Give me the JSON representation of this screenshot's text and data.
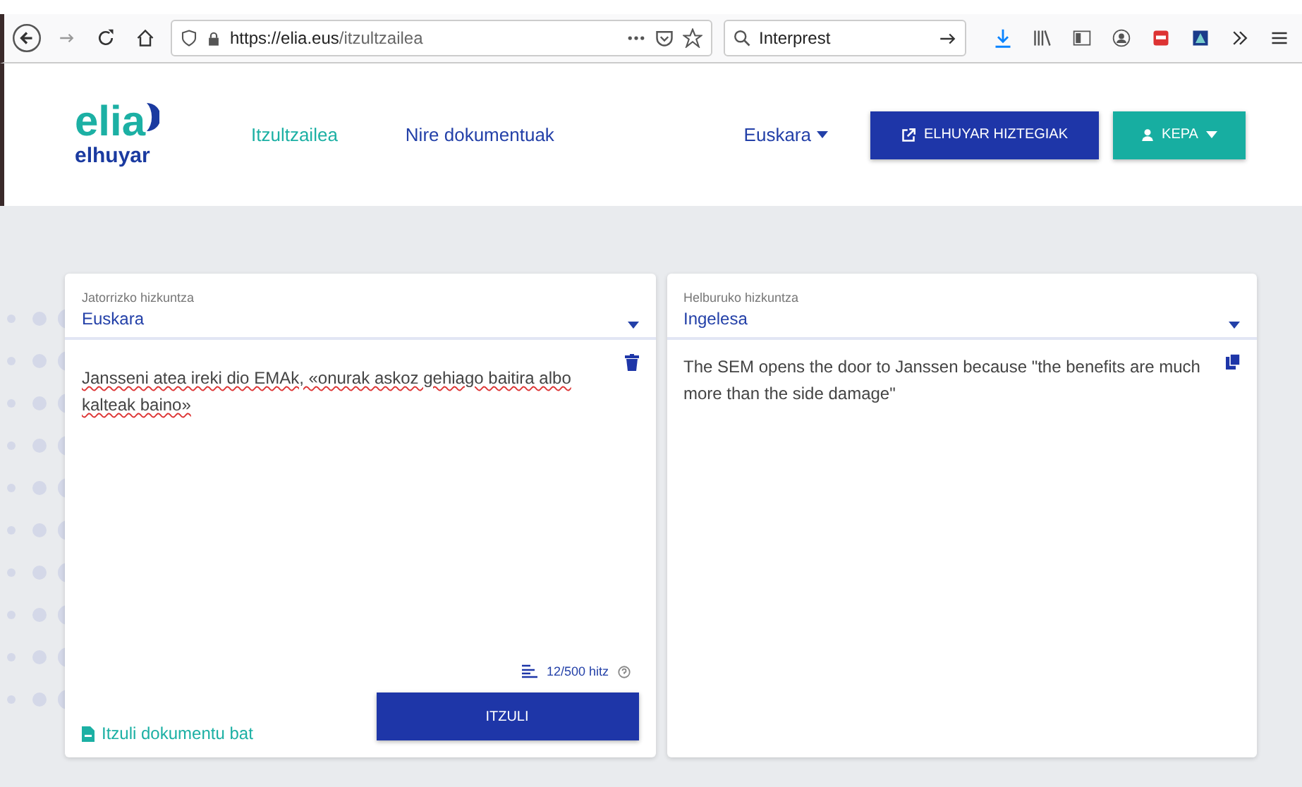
{
  "browser": {
    "url_host": "https://elia.eus",
    "url_path": "/itzultzailea",
    "search": "Interprest"
  },
  "header": {
    "logo": "elia",
    "logo_sub": "elhuyar",
    "nav": [
      {
        "label": "Itzultzailea",
        "selected": true
      },
      {
        "label": "Nire dokumentuak",
        "selected": false
      }
    ],
    "language": "Euskara",
    "dictionaries_button": "ELHUYAR HIZTEGIAK",
    "user_button": "KEPA"
  },
  "source": {
    "label": "Jatorrizko hizkuntza",
    "language": "Euskara",
    "text": "Jansseni atea ireki dio EMAk, «onurak askoz gehiago baitira albo kalteak baino»",
    "word_count": "12/500 hitz",
    "document_link": "Itzuli dokumentu bat",
    "translate_button": "ITZULI"
  },
  "target": {
    "label": "Helburuko hizkuntza",
    "language": "Ingelesa",
    "text": "The SEM opens the door to Janssen because \"the benefits are much more than the side damage\""
  }
}
